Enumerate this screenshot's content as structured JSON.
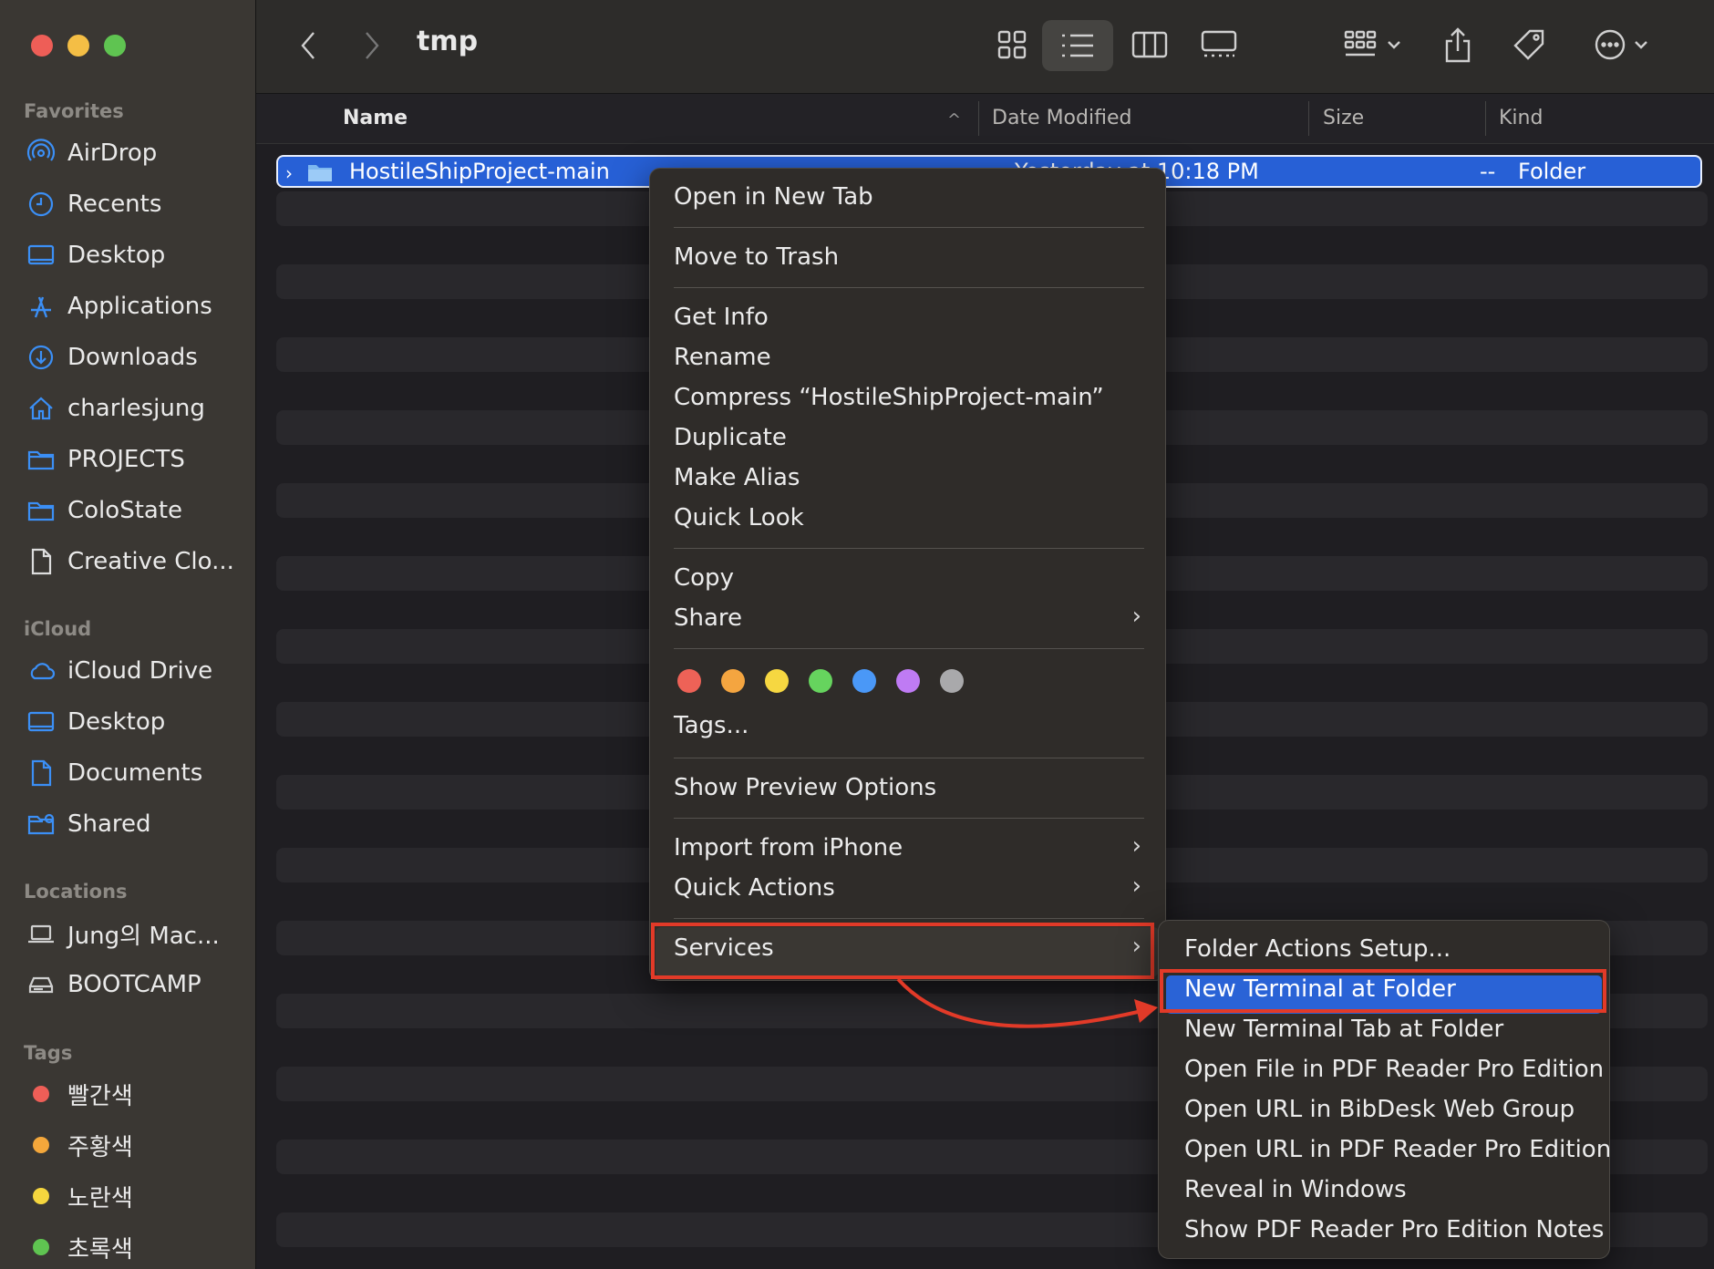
{
  "window": {
    "title": "tmp"
  },
  "sidebar": {
    "favorites_header": "Favorites",
    "favorites": [
      {
        "label": "AirDrop",
        "icon": "airdrop-icon"
      },
      {
        "label": "Recents",
        "icon": "clock-icon"
      },
      {
        "label": "Desktop",
        "icon": "desktop-icon"
      },
      {
        "label": "Applications",
        "icon": "applications-icon"
      },
      {
        "label": "Downloads",
        "icon": "download-icon"
      },
      {
        "label": "charlesjung",
        "icon": "home-icon"
      },
      {
        "label": "PROJECTS",
        "icon": "folder-icon"
      },
      {
        "label": "ColoState",
        "icon": "folder-icon"
      },
      {
        "label": "Creative Clo...",
        "icon": "document-icon"
      }
    ],
    "icloud_header": "iCloud",
    "icloud": [
      {
        "label": "iCloud Drive",
        "icon": "cloud-icon"
      },
      {
        "label": "Desktop",
        "icon": "desktop-icon"
      },
      {
        "label": "Documents",
        "icon": "document-icon"
      },
      {
        "label": "Shared",
        "icon": "shared-folder-icon"
      }
    ],
    "locations_header": "Locations",
    "locations": [
      {
        "label": "Jung의 Mac...",
        "icon": "laptop-icon"
      },
      {
        "label": "BOOTCAMP",
        "icon": "drive-icon"
      }
    ],
    "tags_header": "Tags",
    "tags": [
      {
        "label": "빨간색",
        "color": "#ee5e57"
      },
      {
        "label": "주황색",
        "color": "#f4a73b"
      },
      {
        "label": "노란색",
        "color": "#f5d63e"
      },
      {
        "label": "초록색",
        "color": "#5fc451"
      }
    ]
  },
  "columns": {
    "name": "Name",
    "date": "Date Modified",
    "size": "Size",
    "kind": "Kind"
  },
  "file": {
    "name": "HostileShipProject-main",
    "date": "Yesterday at 10:18 PM",
    "size": "--",
    "kind": "Folder"
  },
  "context_menu": {
    "open_new_tab": "Open in New Tab",
    "move_to_trash": "Move to Trash",
    "get_info": "Get Info",
    "rename": "Rename",
    "compress": "Compress “HostileShipProject-main”",
    "duplicate": "Duplicate",
    "make_alias": "Make Alias",
    "quick_look": "Quick Look",
    "copy": "Copy",
    "share": "Share",
    "tag_colors": [
      "#ee6257",
      "#f4a540",
      "#f6d741",
      "#66d45e",
      "#4a98f7",
      "#bf7bf4",
      "#a9a9ab"
    ],
    "tags": "Tags...",
    "show_preview_options": "Show Preview Options",
    "import_from_iphone": "Import from iPhone",
    "quick_actions": "Quick Actions",
    "services": "Services",
    "submenu_arrow": "›"
  },
  "services_menu": {
    "items": [
      "Folder Actions Setup...",
      "New Terminal at Folder",
      "New Terminal Tab at Folder",
      "Open File in PDF Reader Pro Edition",
      "Open URL in BibDesk Web Group",
      "Open URL in PDF Reader Pro Edition",
      "Reveal in Windows",
      "Show PDF Reader Pro Edition Notes"
    ],
    "selected_index": 1
  },
  "annotation": {
    "color": "#e23a28"
  }
}
